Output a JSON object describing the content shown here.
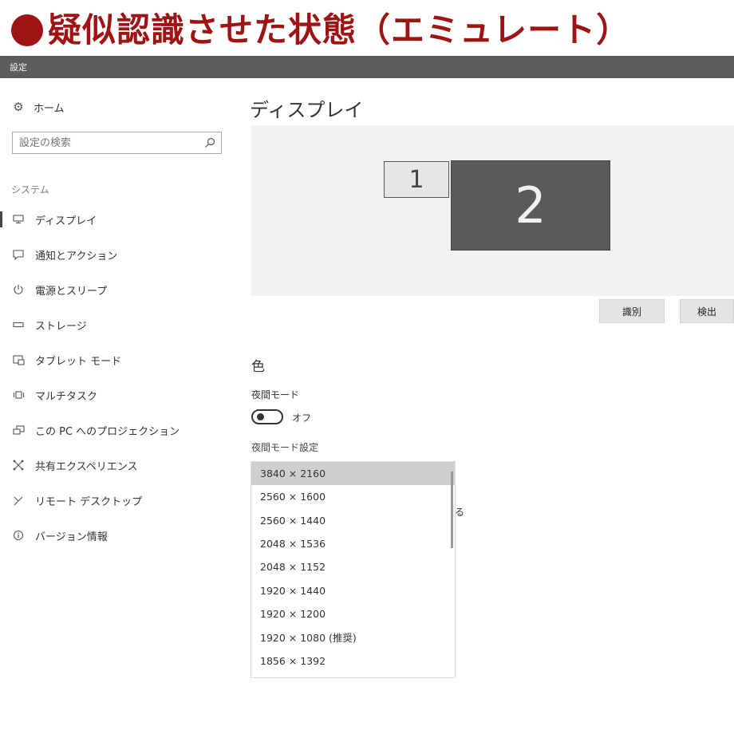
{
  "banner": {
    "text": "疑似認識させた状態（エミュレート）"
  },
  "window": {
    "title": "設定"
  },
  "sidebar": {
    "home_label": "ホーム",
    "search_placeholder": "設定の検索",
    "section_label": "システム",
    "items": [
      {
        "label": "ディスプレイ",
        "icon": "monitor-icon",
        "active": true
      },
      {
        "label": "通知とアクション",
        "icon": "notification-icon"
      },
      {
        "label": "電源とスリープ",
        "icon": "power-icon"
      },
      {
        "label": "ストレージ",
        "icon": "storage-icon"
      },
      {
        "label": "タブレット モード",
        "icon": "tablet-mode-icon"
      },
      {
        "label": "マルチタスク",
        "icon": "multitask-icon"
      },
      {
        "label": "この PC へのプロジェクション",
        "icon": "projection-icon"
      },
      {
        "label": "共有エクスペリエンス",
        "icon": "shared-experience-icon"
      },
      {
        "label": "リモート デスクトップ",
        "icon": "remote-desktop-icon"
      },
      {
        "label": "バージョン情報",
        "icon": "info-icon"
      }
    ]
  },
  "main": {
    "title": "ディスプレイ",
    "monitors": {
      "m1": "1",
      "m2": "2"
    },
    "identify_label": "識別",
    "detect_label": "検出",
    "color_heading": "色",
    "night_mode_label": "夜間モード",
    "toggle_state": "オフ",
    "night_settings_link": "夜間モード設定",
    "peek_char": "る",
    "resolutions": [
      "3840 × 2160",
      "2560 × 1600",
      "2560 × 1440",
      "2048 × 1536",
      "2048 × 1152",
      "1920 × 1440",
      "1920 × 1200",
      "1920 × 1080 (推奨)",
      "1856 × 1392"
    ],
    "selected_resolution": "3840 × 2160"
  },
  "colors": {
    "banner_red": "#9e1414",
    "titlebar": "#5d5d5d",
    "monitor2": "#5a5a5a"
  }
}
